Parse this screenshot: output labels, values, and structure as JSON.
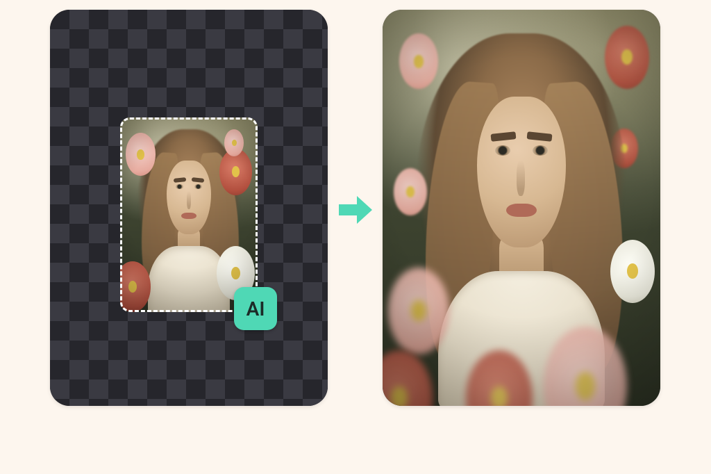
{
  "ai_chip": {
    "label": "AI"
  },
  "colors": {
    "background": "#fdf6ee",
    "accent": "#4fd8b5",
    "checker_dark": "#26262c",
    "checker_light": "#3a3a42"
  },
  "left_card": {
    "kind": "input-canvas-with-transparency",
    "selection": "dashed-marquee-with-original-photo"
  },
  "right_card": {
    "kind": "ai-outpainted-result"
  },
  "arrow": {
    "direction": "right"
  }
}
